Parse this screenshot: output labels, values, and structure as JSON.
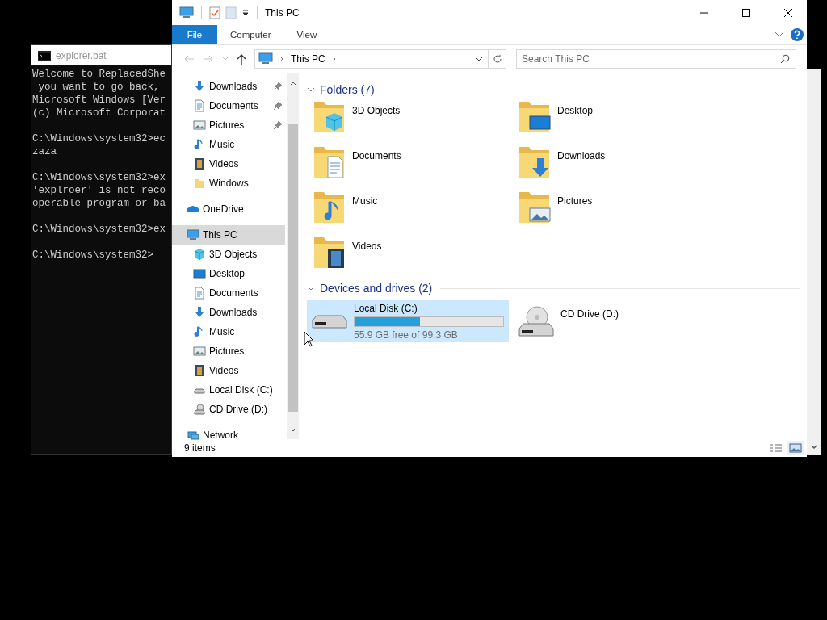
{
  "console": {
    "title": "explorer.bat",
    "blocks": [
      [
        "Welcome to ReplacedShe",
        " you want to go back,",
        "Microsoft Windows [Ver",
        "(c) Microsoft Corporat"
      ],
      [
        "C:\\Windows\\system32>ec",
        "zaza"
      ],
      [
        "C:\\Windows\\system32>ex",
        "'explroer' is not reco",
        "operable program or ba"
      ],
      [
        "C:\\Windows\\system32>ex"
      ],
      [
        "C:\\Windows\\system32>"
      ]
    ]
  },
  "window": {
    "title": "This PC"
  },
  "ribbon_tabs": [
    {
      "label": "File",
      "selected": true
    },
    {
      "label": "Computer",
      "selected": false
    },
    {
      "label": "View",
      "selected": false
    }
  ],
  "address": {
    "breadcrumb": [
      "This PC"
    ]
  },
  "search": {
    "placeholder": "Search This PC"
  },
  "quick_access": [
    {
      "label": "Downloads",
      "kind": "downloads",
      "pinned": true,
      "selected": false
    },
    {
      "label": "Documents",
      "kind": "documents",
      "pinned": true,
      "selected": false
    },
    {
      "label": "Pictures",
      "kind": "pictures",
      "pinned": true,
      "selected": false
    },
    {
      "label": "Music",
      "kind": "music",
      "pinned": false,
      "selected": false
    },
    {
      "label": "Videos",
      "kind": "videos",
      "pinned": false,
      "selected": false
    },
    {
      "label": "Windows",
      "kind": "folder",
      "pinned": false,
      "selected": false
    }
  ],
  "nav": [
    {
      "label": "OneDrive",
      "kind": "onedrive",
      "selected": false
    },
    {
      "label": "This PC",
      "kind": "pc",
      "selected": true,
      "children": [
        {
          "label": "3D Objects",
          "kind": "objects3d",
          "selected": false
        },
        {
          "label": "Desktop",
          "kind": "desktop",
          "selected": false
        },
        {
          "label": "Documents",
          "kind": "documents",
          "selected": false
        },
        {
          "label": "Downloads",
          "kind": "downloads",
          "selected": false
        },
        {
          "label": "Music",
          "kind": "music",
          "selected": false
        },
        {
          "label": "Pictures",
          "kind": "pictures",
          "selected": false
        },
        {
          "label": "Videos",
          "kind": "videos",
          "selected": false
        },
        {
          "label": "Local Disk (C:)",
          "kind": "disk",
          "selected": false
        },
        {
          "label": "CD Drive (D:)",
          "kind": "cd",
          "selected": false
        }
      ]
    },
    {
      "label": "Network",
      "kind": "network",
      "selected": false
    }
  ],
  "folders": {
    "title": "Folders (7)",
    "items": [
      {
        "label": "3D Objects",
        "kind": "objects3d"
      },
      {
        "label": "Desktop",
        "kind": "desktop"
      },
      {
        "label": "Documents",
        "kind": "documents"
      },
      {
        "label": "Downloads",
        "kind": "downloads"
      },
      {
        "label": "Music",
        "kind": "music"
      },
      {
        "label": "Pictures",
        "kind": "pictures"
      },
      {
        "label": "Videos",
        "kind": "videos"
      }
    ]
  },
  "drives": {
    "title": "Devices and drives (2)",
    "items": [
      {
        "label": "Local Disk (C:)",
        "kind": "disk",
        "level": 0.44,
        "detail": "55.9 GB free of 99.3 GB",
        "selected": true
      },
      {
        "label": "CD Drive (D:)",
        "kind": "cd",
        "selected": false
      }
    ]
  },
  "status_bar": {
    "count": "9 items",
    "views": [
      {
        "kind": "details",
        "selected": false
      },
      {
        "kind": "large",
        "selected": true
      }
    ]
  }
}
